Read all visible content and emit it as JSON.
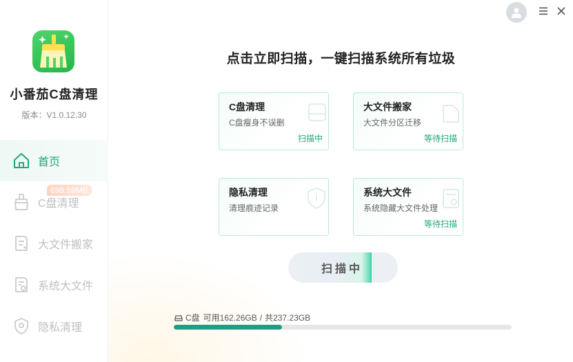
{
  "app": {
    "name": "小番茄C盘清理",
    "version": "版本：V1.0.12.30"
  },
  "sidebar": {
    "items": [
      {
        "label": "首页",
        "icon": "home-icon",
        "active": true
      },
      {
        "label": "C盘清理",
        "icon": "broom-icon",
        "active": false
      },
      {
        "label": "大文件搬家",
        "icon": "file-move-icon",
        "active": false
      },
      {
        "label": "系统大文件",
        "icon": "system-file-icon",
        "active": false
      },
      {
        "label": "隐私清理",
        "icon": "shield-icon",
        "active": false
      }
    ],
    "c_clean_badge": "698.59MB"
  },
  "header": {
    "avatar_icon": "user-avatar-icon",
    "menu_icon": "menu-icon",
    "close_icon": "close-icon"
  },
  "main": {
    "headline": "点击立即扫描，一键扫描系统所有垃圾",
    "cards": [
      {
        "title": "C盘清理",
        "subtitle": "C盘瘦身不误删",
        "status": "扫描中",
        "icon": "disk-icon"
      },
      {
        "title": "大文件搬家",
        "subtitle": "大文件分区迁移",
        "status": "等待扫描",
        "icon": "folder-icon"
      },
      {
        "title": "隐私清理",
        "subtitle": "清理痕迹记录",
        "status": "",
        "icon": "shield-icon"
      },
      {
        "title": "系统大文件",
        "subtitle": "系统隐藏大文件处理",
        "status": "等待扫描",
        "icon": "system-file-icon"
      }
    ],
    "scan_button": {
      "label": "扫描中",
      "progress": 0.76
    },
    "disk": {
      "drive": "C盘",
      "available_label": "可用162.26GB",
      "separator": "/",
      "total_label": "共237.23GB",
      "used_fraction": 0.32
    }
  },
  "colors": {
    "accent": "#21a77b",
    "card_border": "#b9ead9",
    "progress": "#1f9e86",
    "logo_green": "#2fc154"
  }
}
